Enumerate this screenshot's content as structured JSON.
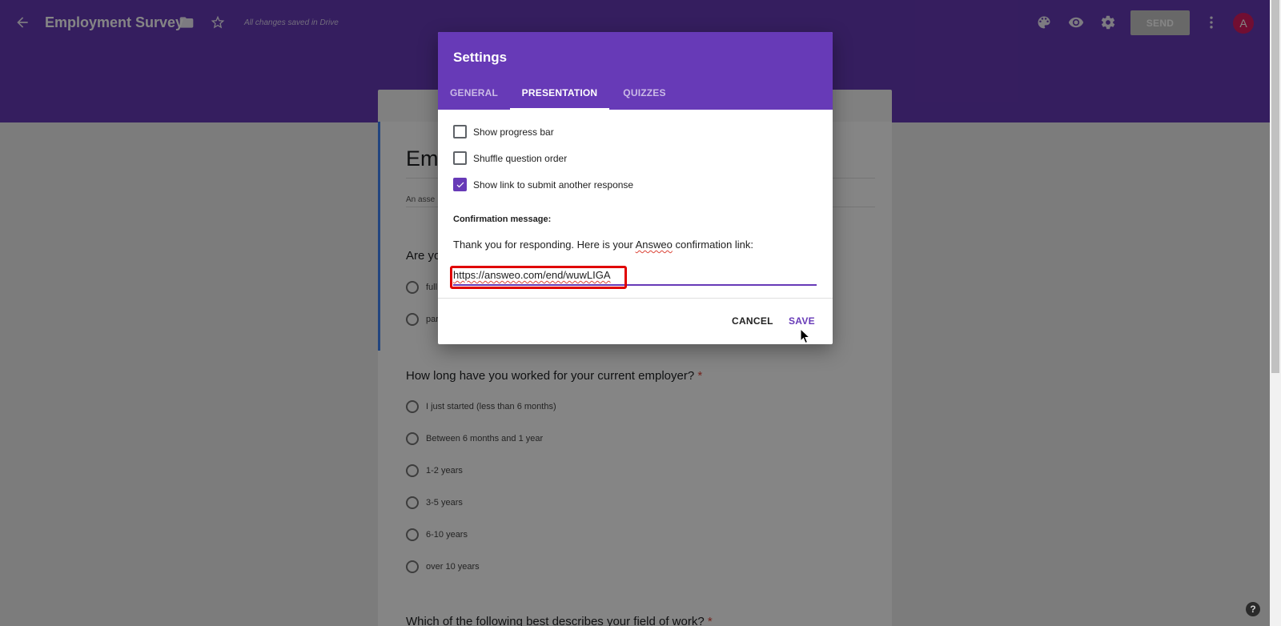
{
  "header": {
    "title": "Employment Survey",
    "saved_status": "All changes saved in Drive",
    "send_label": "SEND",
    "avatar_letter": "A",
    "icons": [
      "back-arrow-icon",
      "folder-icon",
      "star-icon",
      "palette-icon",
      "eye-icon",
      "gear-icon",
      "more-vert-icon"
    ]
  },
  "form": {
    "title_visible": "Em",
    "description_visible": "An asse",
    "q1": {
      "title_visible": "Are yo",
      "options_visible": [
        "full",
        "par"
      ]
    },
    "q2": {
      "title": "How long have you worked for your current employer?",
      "required_mark": "*",
      "options": [
        "I just started (less than 6 months)",
        "Between 6 months and 1 year",
        "1-2 years",
        "3-5 years",
        "6-10 years",
        "over 10 years"
      ]
    },
    "q3": {
      "title": "Which of the following best describes your field of work?",
      "required_mark": "*"
    }
  },
  "dialog": {
    "title": "Settings",
    "tabs": [
      {
        "label": "GENERAL",
        "active": false
      },
      {
        "label": "PRESENTATION",
        "active": true
      },
      {
        "label": "QUIZZES",
        "active": false
      }
    ],
    "options": [
      {
        "label": "Show progress bar",
        "checked": false
      },
      {
        "label": "Shuffle question order",
        "checked": false
      },
      {
        "label": "Show link to submit another response",
        "checked": true
      }
    ],
    "confirmation_label": "Confirmation message:",
    "confirmation_text_before": "Thank you for responding. Here is your ",
    "confirmation_text_brand": "Answeo",
    "confirmation_text_after": " confirmation link:",
    "confirmation_link": "https://answeo.com/end/wuwLIGA",
    "cancel_label": "CANCEL",
    "save_label": "SAVE"
  },
  "help": {
    "label": "?"
  },
  "colors": {
    "primary": "#673ab7",
    "highlight": "#e00000",
    "required": "#db4437"
  }
}
